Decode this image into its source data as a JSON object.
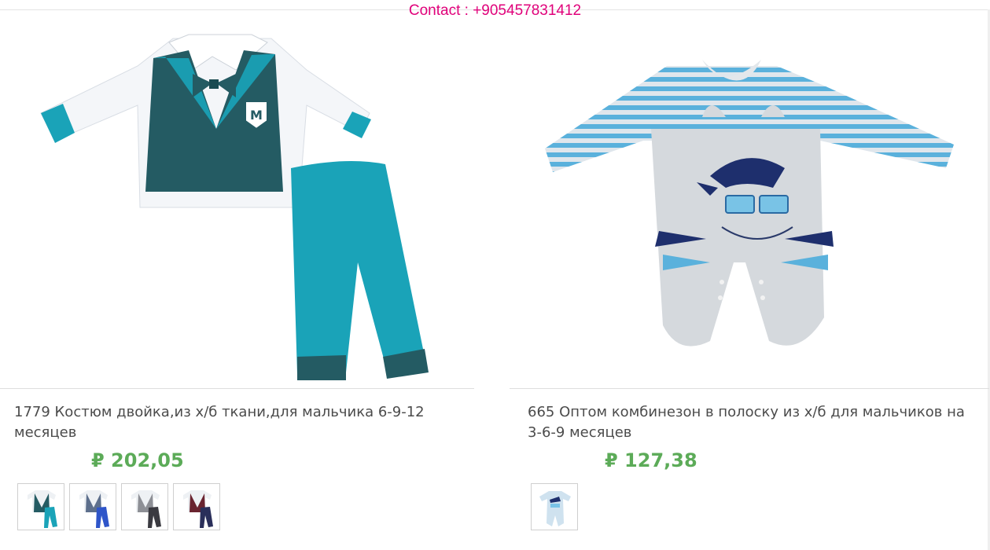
{
  "header": {
    "contact": "Contact : +905457831412"
  },
  "products": [
    {
      "title": "1779 Костюм двойка,из х/б ткани,для мальчика 6-9-12 месяцев",
      "price": "₽ 202,05",
      "thumbnail_count": 4,
      "variant_colors": [
        "#1aa3b8",
        "#2e55c9",
        "#3a3a40",
        "#2a2f5a"
      ]
    },
    {
      "title": "665 Оптом комбинезон в полоску из х/б для мальчиков на 3-6-9 месяцев",
      "price": "₽ 127,38",
      "thumbnail_count": 1,
      "variant_colors": [
        "#8fc9e6"
      ]
    }
  ],
  "colors": {
    "contact": "#e0007a",
    "price": "#5cab58",
    "title": "#4b4b4b"
  }
}
